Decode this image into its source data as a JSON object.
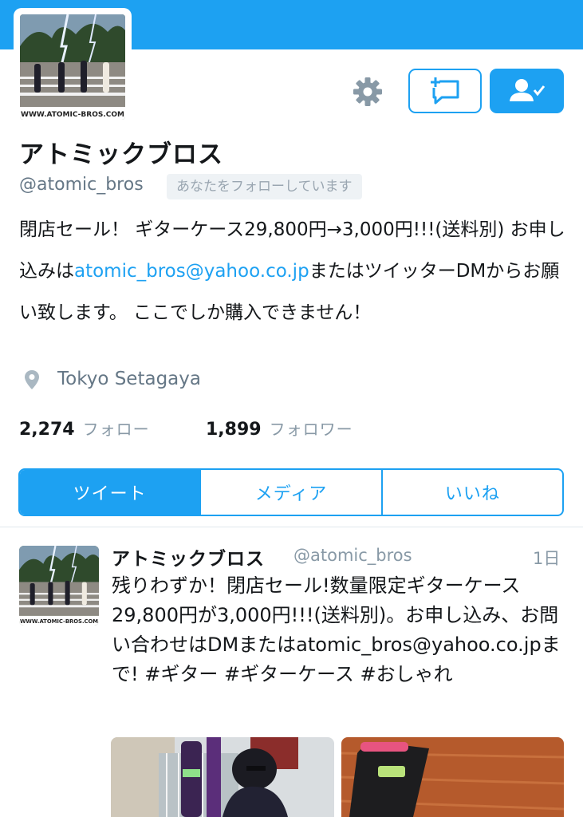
{
  "profile": {
    "name": "アトミックブロス",
    "handle": "@atomic_bros",
    "follows_you": "あなたをフォローしています",
    "bio_part1": "閉店セール！ ギターケース29,800円→3,000円!!!(送料別) お申し込みは",
    "bio_link": "atomic_bros@yahoo.co.jp",
    "bio_part2": "またはツイッターDMからお願い致します。 ここでしか購入できません！",
    "location": "Tokyo Setagaya",
    "avatar_text": "WWW.ATOMIC-BROS.COM"
  },
  "stats": {
    "following_count": "2,274",
    "following_label": "フォロー",
    "followers_count": "1,899",
    "followers_label": "フォロワー"
  },
  "tabs": [
    {
      "label": "ツイート",
      "active": true
    },
    {
      "label": "メディア",
      "active": false
    },
    {
      "label": "いいね",
      "active": false
    }
  ],
  "tweet": {
    "name": "アトミックブロス",
    "handle": "@atomic_bros",
    "time": "1日",
    "text": "残りわずか！閉店セール!数量限定ギターケース29,800円が3,000円!!!(送料別)。お申し込み、お問い合わせはDMまたはatomic_bros@yahoo.co.jpまで! #ギター #ギターケース #おしゃれ",
    "avatar_text": "WWW.ATOMIC-BROS.COM"
  },
  "icons": {
    "settings": "gear-icon",
    "message": "direct-message-icon",
    "following": "user-check-icon",
    "location": "location-pin-icon"
  },
  "colors": {
    "accent": "#1da1f2",
    "muted": "#657786"
  }
}
